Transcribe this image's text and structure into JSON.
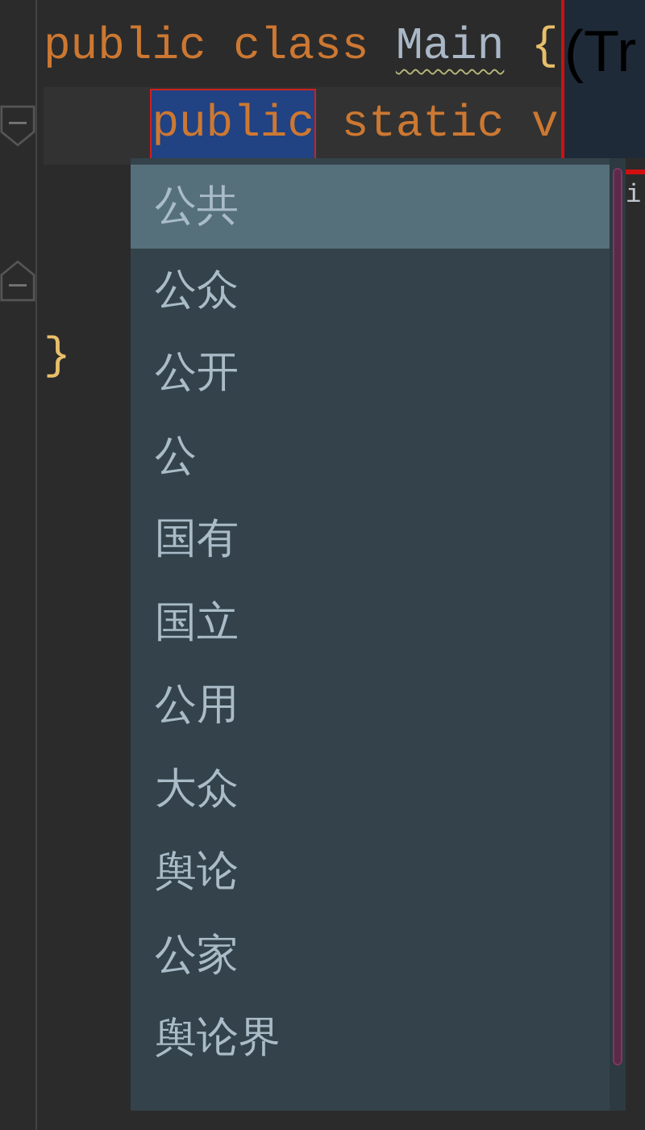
{
  "editor": {
    "lines": [
      {
        "fold_start": false,
        "fold_end": false,
        "tokens": [
          {
            "text": "public",
            "kind": "keyword",
            "selected": false,
            "warning": false
          },
          {
            "text": "class",
            "kind": "keyword",
            "selected": false,
            "warning": false
          },
          {
            "text": "Main",
            "kind": "identifier",
            "selected": false,
            "warning": true
          },
          {
            "text": "{",
            "kind": "open-brace",
            "selected": false,
            "warning": false
          }
        ]
      },
      {
        "fold_start": true,
        "fold_end": false,
        "tokens": [
          {
            "text": "public",
            "kind": "keyword",
            "selected": true,
            "warning": false
          },
          {
            "text": "static",
            "kind": "keyword",
            "selected": false,
            "warning": false
          },
          {
            "text": "v",
            "kind": "keyword",
            "selected": false,
            "warning": false
          }
        ]
      },
      {
        "fold_start": false,
        "fold_end": false
      },
      {
        "fold_start": false,
        "fold_end": true
      },
      {
        "fold_start": false,
        "fold_end": false,
        "tokens": [
          {
            "text": "}",
            "kind": "close-brace",
            "selected": false,
            "warning": false
          }
        ]
      }
    ]
  },
  "side_panel": {
    "text": "(Tr"
  },
  "lower_panel": {
    "text": "i"
  },
  "suggestions": [
    {
      "text": "公共",
      "selected": true
    },
    {
      "text": "公众",
      "selected": false
    },
    {
      "text": "公开",
      "selected": false
    },
    {
      "text": "公",
      "selected": false
    },
    {
      "text": "国有",
      "selected": false
    },
    {
      "text": "国立",
      "selected": false
    },
    {
      "text": "公用",
      "selected": false
    },
    {
      "text": "大众",
      "selected": false
    },
    {
      "text": "舆论",
      "selected": false
    },
    {
      "text": "公家",
      "selected": false
    },
    {
      "text": "舆论界",
      "selected": false
    }
  ]
}
